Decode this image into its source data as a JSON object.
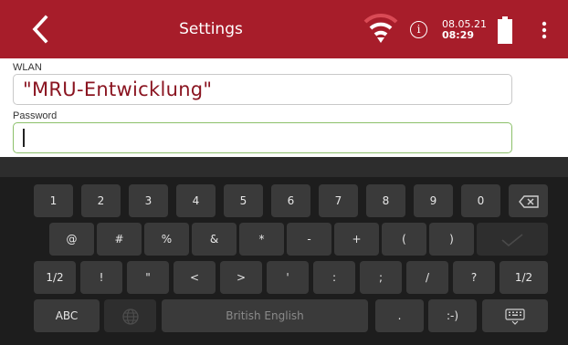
{
  "header": {
    "title": "Settings",
    "date": "08.05.21",
    "time": "08:29",
    "info_glyph": "i",
    "background": "#a71d2a",
    "icons": [
      "back-arrow-icon",
      "wifi-signal-icon",
      "info-icon",
      "battery-icon",
      "more-vert-icon"
    ]
  },
  "form": {
    "wlan_label": "WLAN",
    "wlan_value": "\"MRU-Entwicklung\"",
    "password_label": "Password",
    "password_value": "",
    "wlan_text_color": "#8a1420",
    "focus_border_color": "#8cc06a"
  },
  "keyboard": {
    "row1": [
      "1",
      "2",
      "3",
      "4",
      "5",
      "6",
      "7",
      "8",
      "9",
      "0"
    ],
    "row2": [
      "@",
      "#",
      "%",
      "&",
      "*",
      "-",
      "+",
      "(",
      ")"
    ],
    "row3": [
      "1/2",
      "!",
      "\"",
      "<",
      ">",
      "'",
      ":",
      ";",
      "/",
      "?",
      "1/2"
    ],
    "row4": {
      "abc": "ABC",
      "space": "British English",
      "dot": ".",
      "smiley": ":-)"
    },
    "icons": [
      "backspace-icon",
      "checkmark-icon",
      "globe-icon",
      "keyboard-hide-icon"
    ]
  }
}
